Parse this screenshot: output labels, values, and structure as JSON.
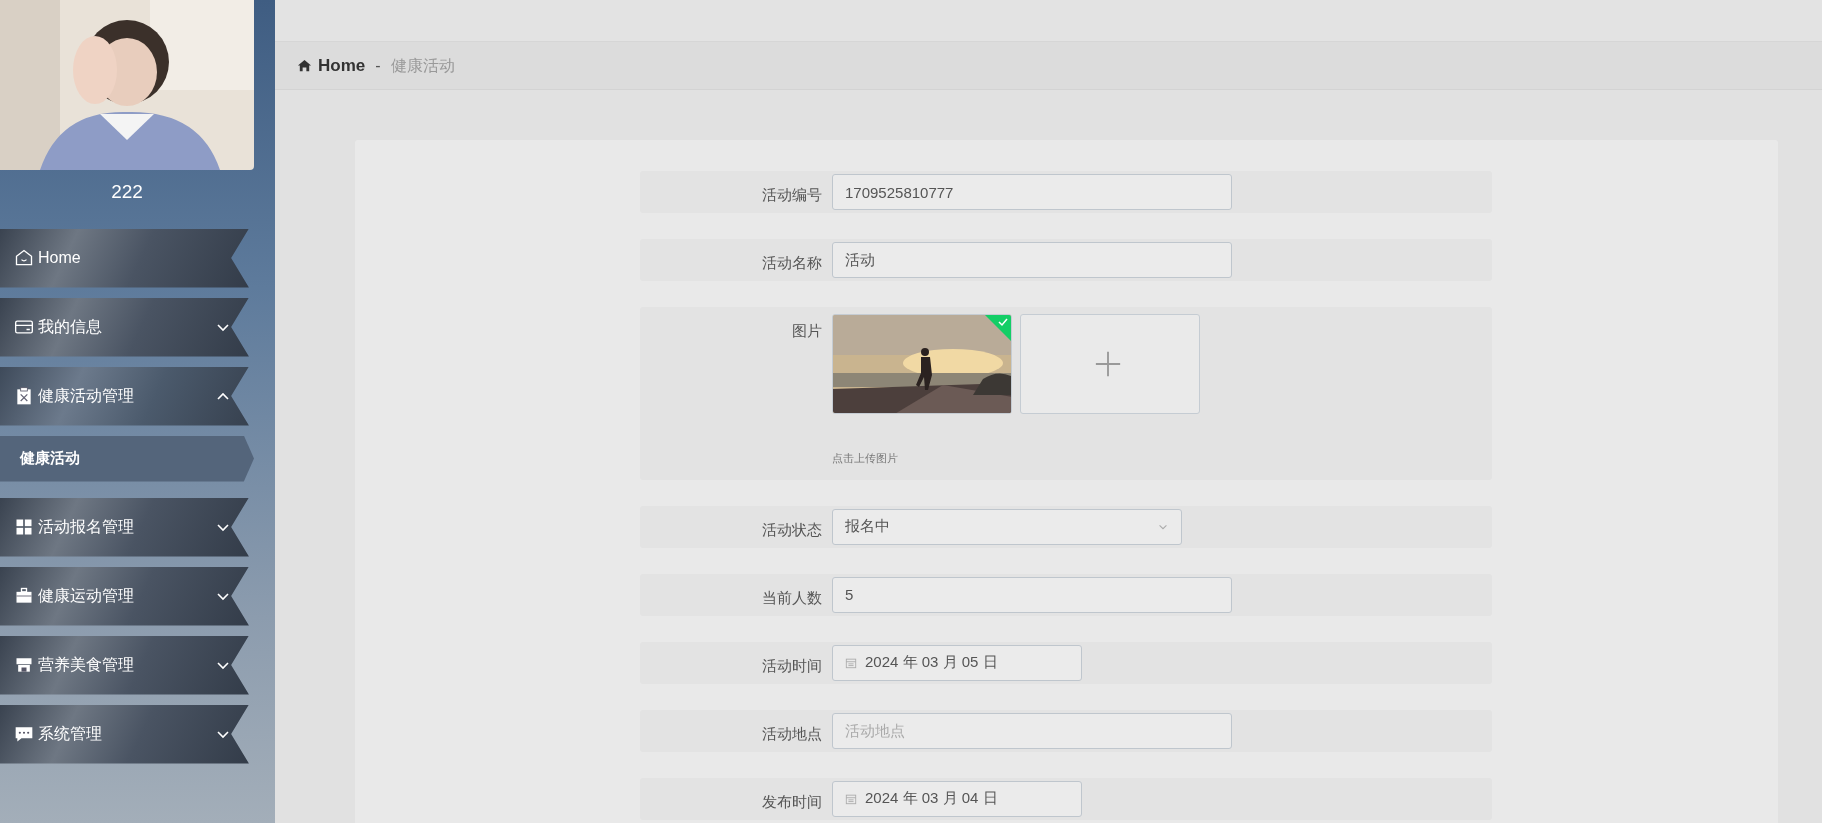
{
  "sidebar": {
    "avatar": {
      "kind": "picture"
    },
    "username": "222",
    "menu": [
      {
        "label": "Home",
        "kind": "link",
        "expanded": false
      },
      {
        "label": "我的信息",
        "kind": "group",
        "expanded": false
      },
      {
        "label": "健康活动管理",
        "kind": "group",
        "expanded": true,
        "children": [
          {
            "label": "健康活动",
            "selected": true
          }
        ]
      },
      {
        "label": "活动报名管理",
        "kind": "group",
        "expanded": false
      },
      {
        "label": "健康运动管理",
        "kind": "group",
        "expanded": false
      },
      {
        "label": "营养美食管理",
        "kind": "group",
        "expanded": false
      },
      {
        "label": "系统管理",
        "kind": "group",
        "expanded": false
      }
    ]
  },
  "breadcrumb": {
    "home": "Home",
    "separator": "-",
    "current": "健康活动"
  },
  "form": {
    "fields": [
      {
        "label": "活动编号",
        "kind": "text",
        "value": "1709525810777"
      },
      {
        "label": "活动名称",
        "kind": "text",
        "value": "活动"
      },
      {
        "label": "图片",
        "kind": "upload",
        "hint": "点击上传图片",
        "images": [
          {
            "kind": "picture",
            "uploaded": true
          }
        ]
      },
      {
        "label": "活动状态",
        "kind": "select",
        "value": "报名中"
      },
      {
        "label": "当前人数",
        "kind": "text",
        "value": "5"
      },
      {
        "label": "活动时间",
        "kind": "date",
        "value": "2024 年 03 月 05 日"
      },
      {
        "label": "活动地点",
        "kind": "text",
        "placeholder": "活动地点"
      },
      {
        "label": "发布时间",
        "kind": "date",
        "value": "2024 年 03 月 04 日"
      }
    ]
  }
}
